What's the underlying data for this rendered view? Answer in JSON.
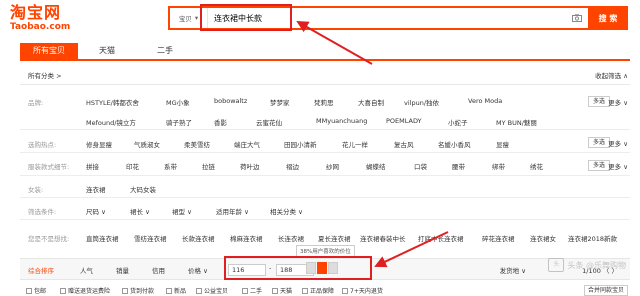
{
  "logo": {
    "cn": "淘宝网",
    "en": "Taobao.com"
  },
  "search": {
    "scope": "宝贝",
    "query": "连衣裙中长款",
    "button": "搜 索"
  },
  "tabs": [
    "所有宝贝",
    "天猫",
    "二手"
  ],
  "breadcrumb": "所有分类 >",
  "collapse_filter": "收起筛选 ∧",
  "filters": {
    "brand": {
      "label": "品牌:",
      "items": [
        "HSTYLE/韩都衣舍",
        "MG小象",
        "bobowaltz",
        "梦梦家",
        "梵莉思",
        "大喜自制",
        "vilpun/独依",
        "Vero Moda",
        "Mefound/镜立方",
        "骑子熟了",
        "香影",
        "云蜜花仙",
        "MMyuanchuang",
        "POEMLADY",
        "小蛇子",
        "MY BUN/魅丽"
      ],
      "multi": "多选",
      "more": "更多 ∨"
    },
    "hot": {
      "label": "选购热点:",
      "items": [
        "修身显瘦",
        "气质淑女",
        "柔美雪纺",
        "端庄大气",
        "田园小清新",
        "花儿一样",
        "复古风",
        "名媛小香风",
        "显瘦"
      ],
      "multi": "多选",
      "more": "更多 ∨"
    },
    "detail": {
      "label": "服装款式细节:",
      "items": [
        "拼接",
        "印花",
        "系带",
        "拉链",
        "荷叶边",
        "褶边",
        "纱网",
        "蝴蝶结",
        "口袋",
        "腰带",
        "绑带",
        "绣花"
      ],
      "multi": "多选",
      "more": "更多 ∨"
    },
    "style": {
      "label": "女装:",
      "items": [
        "连衣裙",
        "大码女装"
      ]
    },
    "conditions": {
      "label": "筛选条件:",
      "items": [
        "尺码 ∨",
        "裙长 ∨",
        "裙型 ∨",
        "适用年龄 ∨",
        "相关分类 ∨"
      ]
    }
  },
  "guess": {
    "label": "您是不是想找:",
    "items": [
      "直筒连衣裙",
      "雪纺连衣裙",
      "长款连衣裙",
      "棉麻连衣裙",
      "长连衣裙",
      "夏长连衣裙",
      "连衣裙春装中长",
      "打底中长连衣裙",
      "碎花连衣裙",
      "连衣裙女",
      "连衣裙2018新款"
    ]
  },
  "sort": {
    "items": [
      "综合排序",
      "人气",
      "销量",
      "信用",
      "价格 ∨"
    ],
    "price_min": "116",
    "price_max": "188",
    "tooltip": "38%用户喜欢的价位",
    "ship": "发货地 ∨",
    "pager": "1/100 〈 〉"
  },
  "checks": [
    "包邮",
    "赠送退货运费险",
    "货到付款",
    "新品",
    "公益宝贝",
    "二手",
    "天猫",
    "正品保障",
    "7+天内退货"
  ],
  "combine": "合并同款宝贝",
  "watermark": "头条 @乐舞购物"
}
